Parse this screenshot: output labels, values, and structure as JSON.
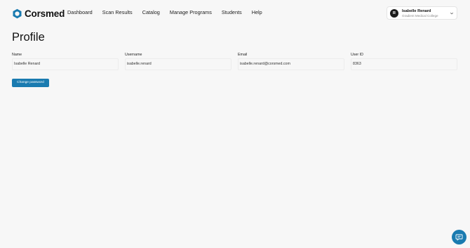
{
  "brand": {
    "name": "Corsmed",
    "accent": "#1a7bb0"
  },
  "nav": {
    "items": [
      {
        "label": "Dashboard"
      },
      {
        "label": "Scan Results"
      },
      {
        "label": "Catalog"
      },
      {
        "label": "Manage Programs"
      },
      {
        "label": "Students"
      },
      {
        "label": "Help"
      }
    ]
  },
  "user": {
    "initial": "R",
    "name": "Isabelle Renard",
    "organization": "Gradient Medical College"
  },
  "page": {
    "title": "Profile"
  },
  "profile": {
    "fields": [
      {
        "label": "Name",
        "value": "Isabelle Renard"
      },
      {
        "label": "Username",
        "value": "isabelle.renard"
      },
      {
        "label": "Email",
        "value": "isabelle.renard@corsmed.com"
      },
      {
        "label": "User ID",
        "value": "8363"
      }
    ],
    "change_password_label": "Change password"
  },
  "icons": {
    "logo": "corsmed-logo-icon",
    "dropdown": "chevron-down-icon",
    "chat": "chat-icon"
  }
}
